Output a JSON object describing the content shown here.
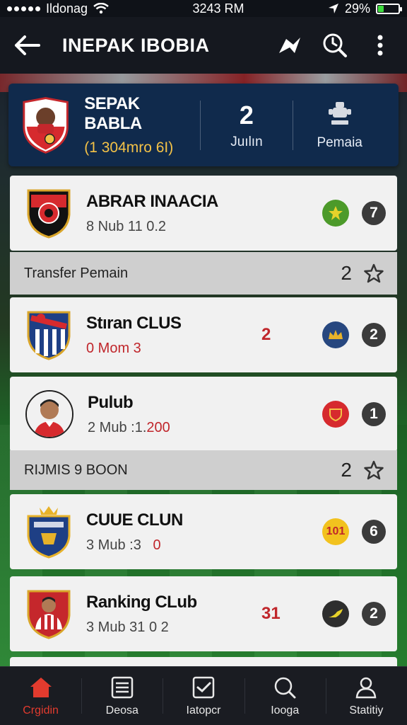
{
  "status_bar": {
    "carrier": "Ildonag",
    "time": "3243 RM",
    "battery": "29%",
    "battery_level": 0.29
  },
  "app_bar": {
    "title": "INEPAK IBOBIA"
  },
  "hero": {
    "club_name": "SEPAK BABLA",
    "club_sub": "(1 304mro 6I)",
    "stat_value": "2",
    "stat_label": "Juılın",
    "player_label": "Pemaia"
  },
  "rows": [
    {
      "name": "ABRAR INAACIA",
      "meta": "8 Nub 11 0.2",
      "mid": "",
      "icon": "green-star",
      "count": "7"
    },
    {
      "name": "Stıran CLUS",
      "meta": "0 Mom 3",
      "mid": "2",
      "icon": "blue-crown",
      "count": "2"
    },
    {
      "name": "Pulub",
      "meta_a": "2 Mub :1.",
      "meta_b": "200",
      "mid": "",
      "icon": "red-shield",
      "count": "1"
    },
    {
      "name": "CUUE CLUN",
      "meta_a": "3 Mub :3",
      "meta_b": "0",
      "mid": "",
      "icon": "yellow-badge",
      "badge_text": "101",
      "count": "6"
    },
    {
      "name": "Ranking CLub",
      "meta": "3 Mub 31 0 2",
      "mid": "31",
      "icon": "dark-boot",
      "count": "2"
    }
  ],
  "sections": [
    {
      "label": "Transfer Pemain",
      "count": "2"
    },
    {
      "label": "RIJMIS 9 BOON",
      "count": "2"
    }
  ],
  "bottom_nav": [
    {
      "label": "Crgidin",
      "icon": "home-icon",
      "active": true
    },
    {
      "label": "Deosa",
      "icon": "list-icon",
      "active": false
    },
    {
      "label": "Iatopcr",
      "icon": "checkbox-icon",
      "active": false
    },
    {
      "label": "Iooga",
      "icon": "search-icon",
      "active": false
    },
    {
      "label": "Statitiy",
      "icon": "profile-icon",
      "active": false
    }
  ],
  "colors": {
    "accent": "#e23b2e",
    "hero_bg": "#102a4c",
    "row_bg": "#f1f1f1",
    "section_bg": "#cfcfcf"
  }
}
